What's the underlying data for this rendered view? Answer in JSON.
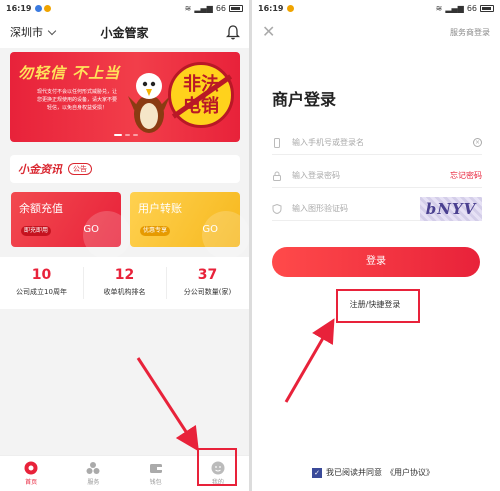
{
  "left_screen": {
    "status_bar": {
      "time": "16:19",
      "battery": "66"
    },
    "header": {
      "city": "深圳市",
      "title": "小金管家"
    },
    "banner": {
      "headline": "勿轻信 不上当",
      "copy": "现代支付不会以任何形式威胁兑，让您更换正规使用的设备，请大家不要轻信，以免自身权益受损！",
      "pill": "",
      "stamp_line1": "非法",
      "stamp_line2": "电销"
    },
    "news": {
      "logo": "小金资讯",
      "badge": "公告"
    },
    "cards": [
      {
        "title": "余额充值",
        "tag": "即充即用",
        "go": "GO"
      },
      {
        "title": "用户转账",
        "tag": "优惠专享",
        "go": "GO"
      }
    ],
    "stats": [
      {
        "value": "10",
        "label": "公司成立10周年"
      },
      {
        "value": "12",
        "label": "收单机构排名"
      },
      {
        "value": "37",
        "label": "分公司数量(家)"
      }
    ],
    "tabs": [
      {
        "label": "首页",
        "icon": "home-icon"
      },
      {
        "label": "服务",
        "icon": "services-icon"
      },
      {
        "label": "钱包",
        "icon": "wallet-icon"
      },
      {
        "label": "我的",
        "icon": "profile-icon"
      }
    ]
  },
  "right_screen": {
    "status_bar": {
      "time": "16:19",
      "battery": "66"
    },
    "header": {
      "link": "服务商登录"
    },
    "title": "商户登录",
    "fields": {
      "phone_placeholder": "输入手机号或登录名",
      "password_placeholder": "输入登录密码",
      "forgot": "忘记密码",
      "captcha_placeholder": "输入图形验证码",
      "captcha_code": "bNYV"
    },
    "login_button": "登录",
    "register_link": "注册/快捷登录",
    "agreement": {
      "prefix": "我已阅读并同意",
      "link": "《用户协议》"
    }
  },
  "colors": {
    "accent": "#e8223a",
    "yellow": "#f6b81e",
    "annotation": "#e8223a"
  }
}
